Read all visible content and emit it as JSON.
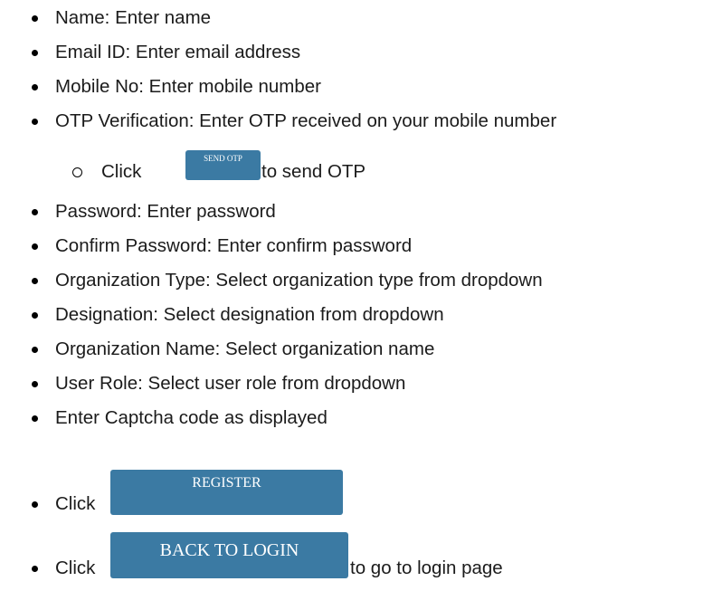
{
  "instructions": {
    "items": [
      {
        "text": "Name: Enter name"
      },
      {
        "text": "Email ID: Enter email address"
      },
      {
        "text": "Mobile No: Enter mobile number"
      },
      {
        "text": "OTP Verification: Enter OTP received on your mobile number"
      },
      {
        "text": "Password: Enter password"
      },
      {
        "text": "Confirm Password: Enter confirm password"
      },
      {
        "text": "Organization Type: Select organization type from dropdown"
      },
      {
        "text": "Designation: Select designation from dropdown"
      },
      {
        "text": "Organization Name: Select organization name"
      },
      {
        "text": "User Role: Select user role from dropdown"
      },
      {
        "text": "Enter Captcha code as displayed"
      }
    ],
    "send_otp_step": {
      "prefix": "Click",
      "button_label": "SEND OTP",
      "suffix": "to send OTP"
    },
    "register_step": {
      "prefix": "Click",
      "button_label": "REGISTER"
    },
    "back_to_login_step": {
      "prefix": "Click",
      "button_label": "BACK TO LOGIN",
      "suffix": "to go to login page"
    }
  },
  "colors": {
    "button_background": "#3b7aa3",
    "button_text": "#ffffff",
    "text": "#1b1b1b"
  }
}
